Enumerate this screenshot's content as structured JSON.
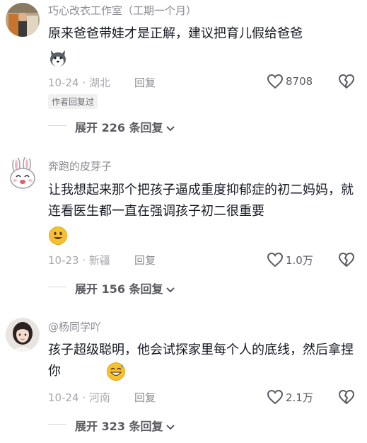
{
  "comments": [
    {
      "username": "巧心改衣工作室（工期一个月）",
      "text": "原来爸爸带娃才是正解，建议把育儿假给爸爸",
      "emoji": "husky-face-emoji",
      "date_location": "10-24 · 湖北",
      "reply_label": "回复",
      "likes": "8708",
      "author_tag": "作者回复过",
      "expand_label": "展开 226 条回复"
    },
    {
      "username": "奔跑的皮芽子",
      "text": "让我想起来那个把孩子逼成重度抑郁症的初二妈妈，就连看医生都一直在强调孩子初二很重要",
      "emoji": "smile-face-emoji",
      "date_location": "10-23 · 新疆",
      "reply_label": "回复",
      "likes": "1.0万",
      "expand_label": "展开 156 条回复"
    },
    {
      "username": "@杨同学吖",
      "text": "孩子超级聪明，他会试探家里每个人的底线，然后拿捏你",
      "emoji": "sweat-smile-emoji",
      "date_location": "10-24 · 河南",
      "reply_label": "回复",
      "likes": "2.1万",
      "expand_label": "展开 323 条回复"
    }
  ],
  "colors": {
    "text": "#161823",
    "secondary": "#8a8b91",
    "emoji_yellow": "#f7c12e"
  }
}
